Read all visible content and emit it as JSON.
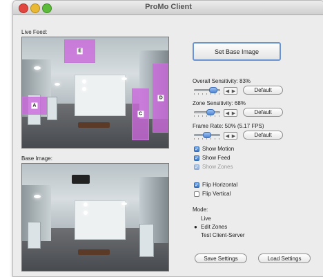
{
  "window": {
    "title": "ProMo Client"
  },
  "live_feed": {
    "label": "Live Feed:",
    "zones": [
      "E",
      "A",
      "C",
      "D"
    ]
  },
  "base_image": {
    "label": "Base Image:"
  },
  "controls": {
    "set_base_image": "Set Base Image",
    "overall_sensitivity": {
      "label": "Overall Sensitivity: 83%",
      "value_percent": 83,
      "default_button": "Default"
    },
    "zone_sensitivity": {
      "label": "Zone Sensitivity: 68%",
      "value_percent": 68,
      "default_button": "Default"
    },
    "frame_rate": {
      "label": "Frame Rate: 50% (5.17 FPS)",
      "value_percent": 50,
      "default_button": "Default"
    }
  },
  "options": {
    "show_motion": {
      "label": "Show Motion",
      "checked": true
    },
    "show_feed": {
      "label": "Show Feed",
      "checked": true
    },
    "show_zones": {
      "label": "Show Zones",
      "checked": true,
      "enabled": false
    },
    "flip_horizontal": {
      "label": "Flip Horizontal",
      "checked": true
    },
    "flip_vertical": {
      "label": "Flip Vertical",
      "checked": false
    }
  },
  "mode": {
    "label": "Mode:",
    "options": [
      "Live",
      "Edit Zones",
      "Test Client-Server"
    ],
    "selected": "Edit Zones"
  },
  "footer": {
    "save": "Save Settings",
    "load": "Load Settings"
  },
  "colors": {
    "zone": "#cc66dd",
    "accent": "#3c78cc"
  }
}
